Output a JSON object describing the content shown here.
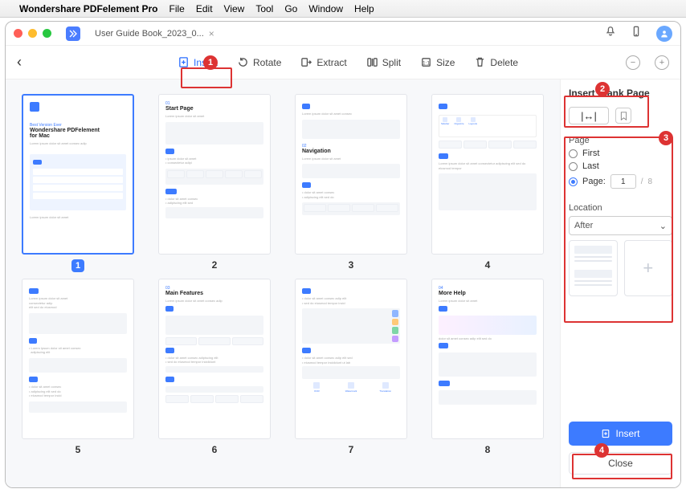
{
  "menubar": {
    "app_name": "Wondershare PDFelement Pro",
    "items": [
      "File",
      "Edit",
      "View",
      "Tool",
      "Go",
      "Window",
      "Help"
    ]
  },
  "titlebar": {
    "tab_name": "User Guide Book_2023_0...",
    "close_x": "×"
  },
  "toolbar": {
    "insert": "Insert",
    "rotate": "Rotate",
    "extract": "Extract",
    "split": "Split",
    "size": "Size",
    "delete": "Delete"
  },
  "pages": {
    "labels": [
      "1",
      "2",
      "3",
      "4",
      "5",
      "6",
      "7",
      "8"
    ],
    "thumb1_heading": "Wondershare PDFelement\nfor Mac",
    "thumb1_top": "Best Version Ever",
    "thumb2_heading": "Start Page",
    "thumb3_heading": "Navigation",
    "thumb6_heading": "Main Features",
    "thumb8_heading": "More Help"
  },
  "panel": {
    "title": "Insert Blank Page",
    "count_value": "|↔|",
    "section_page": "Page",
    "radio_first": "First",
    "radio_last": "Last",
    "radio_page": "Page:",
    "page_value": "1",
    "page_sep": "/",
    "page_total": "8",
    "section_location": "Location",
    "location_value": "After",
    "insert_btn": "Insert",
    "close_btn": "Close"
  },
  "callouts": {
    "b1": "1",
    "b2": "2",
    "b3": "3",
    "b4": "4"
  }
}
